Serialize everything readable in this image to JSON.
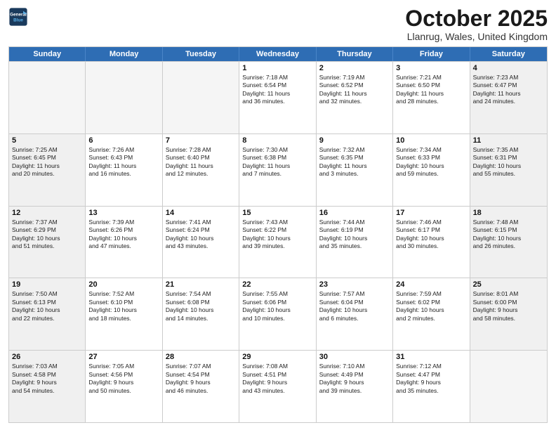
{
  "header": {
    "logo_line1": "General",
    "logo_line2": "Blue",
    "month": "October 2025",
    "location": "Llanrug, Wales, United Kingdom"
  },
  "days_of_week": [
    "Sunday",
    "Monday",
    "Tuesday",
    "Wednesday",
    "Thursday",
    "Friday",
    "Saturday"
  ],
  "weeks": [
    [
      {
        "day": "",
        "text": ""
      },
      {
        "day": "",
        "text": ""
      },
      {
        "day": "",
        "text": ""
      },
      {
        "day": "1",
        "text": "Sunrise: 7:18 AM\nSunset: 6:54 PM\nDaylight: 11 hours\nand 36 minutes."
      },
      {
        "day": "2",
        "text": "Sunrise: 7:19 AM\nSunset: 6:52 PM\nDaylight: 11 hours\nand 32 minutes."
      },
      {
        "day": "3",
        "text": "Sunrise: 7:21 AM\nSunset: 6:50 PM\nDaylight: 11 hours\nand 28 minutes."
      },
      {
        "day": "4",
        "text": "Sunrise: 7:23 AM\nSunset: 6:47 PM\nDaylight: 11 hours\nand 24 minutes."
      }
    ],
    [
      {
        "day": "5",
        "text": "Sunrise: 7:25 AM\nSunset: 6:45 PM\nDaylight: 11 hours\nand 20 minutes."
      },
      {
        "day": "6",
        "text": "Sunrise: 7:26 AM\nSunset: 6:43 PM\nDaylight: 11 hours\nand 16 minutes."
      },
      {
        "day": "7",
        "text": "Sunrise: 7:28 AM\nSunset: 6:40 PM\nDaylight: 11 hours\nand 12 minutes."
      },
      {
        "day": "8",
        "text": "Sunrise: 7:30 AM\nSunset: 6:38 PM\nDaylight: 11 hours\nand 7 minutes."
      },
      {
        "day": "9",
        "text": "Sunrise: 7:32 AM\nSunset: 6:35 PM\nDaylight: 11 hours\nand 3 minutes."
      },
      {
        "day": "10",
        "text": "Sunrise: 7:34 AM\nSunset: 6:33 PM\nDaylight: 10 hours\nand 59 minutes."
      },
      {
        "day": "11",
        "text": "Sunrise: 7:35 AM\nSunset: 6:31 PM\nDaylight: 10 hours\nand 55 minutes."
      }
    ],
    [
      {
        "day": "12",
        "text": "Sunrise: 7:37 AM\nSunset: 6:29 PM\nDaylight: 10 hours\nand 51 minutes."
      },
      {
        "day": "13",
        "text": "Sunrise: 7:39 AM\nSunset: 6:26 PM\nDaylight: 10 hours\nand 47 minutes."
      },
      {
        "day": "14",
        "text": "Sunrise: 7:41 AM\nSunset: 6:24 PM\nDaylight: 10 hours\nand 43 minutes."
      },
      {
        "day": "15",
        "text": "Sunrise: 7:43 AM\nSunset: 6:22 PM\nDaylight: 10 hours\nand 39 minutes."
      },
      {
        "day": "16",
        "text": "Sunrise: 7:44 AM\nSunset: 6:19 PM\nDaylight: 10 hours\nand 35 minutes."
      },
      {
        "day": "17",
        "text": "Sunrise: 7:46 AM\nSunset: 6:17 PM\nDaylight: 10 hours\nand 30 minutes."
      },
      {
        "day": "18",
        "text": "Sunrise: 7:48 AM\nSunset: 6:15 PM\nDaylight: 10 hours\nand 26 minutes."
      }
    ],
    [
      {
        "day": "19",
        "text": "Sunrise: 7:50 AM\nSunset: 6:13 PM\nDaylight: 10 hours\nand 22 minutes."
      },
      {
        "day": "20",
        "text": "Sunrise: 7:52 AM\nSunset: 6:10 PM\nDaylight: 10 hours\nand 18 minutes."
      },
      {
        "day": "21",
        "text": "Sunrise: 7:54 AM\nSunset: 6:08 PM\nDaylight: 10 hours\nand 14 minutes."
      },
      {
        "day": "22",
        "text": "Sunrise: 7:55 AM\nSunset: 6:06 PM\nDaylight: 10 hours\nand 10 minutes."
      },
      {
        "day": "23",
        "text": "Sunrise: 7:57 AM\nSunset: 6:04 PM\nDaylight: 10 hours\nand 6 minutes."
      },
      {
        "day": "24",
        "text": "Sunrise: 7:59 AM\nSunset: 6:02 PM\nDaylight: 10 hours\nand 2 minutes."
      },
      {
        "day": "25",
        "text": "Sunrise: 8:01 AM\nSunset: 6:00 PM\nDaylight: 9 hours\nand 58 minutes."
      }
    ],
    [
      {
        "day": "26",
        "text": "Sunrise: 7:03 AM\nSunset: 4:58 PM\nDaylight: 9 hours\nand 54 minutes."
      },
      {
        "day": "27",
        "text": "Sunrise: 7:05 AM\nSunset: 4:56 PM\nDaylight: 9 hours\nand 50 minutes."
      },
      {
        "day": "28",
        "text": "Sunrise: 7:07 AM\nSunset: 4:54 PM\nDaylight: 9 hours\nand 46 minutes."
      },
      {
        "day": "29",
        "text": "Sunrise: 7:08 AM\nSunset: 4:51 PM\nDaylight: 9 hours\nand 43 minutes."
      },
      {
        "day": "30",
        "text": "Sunrise: 7:10 AM\nSunset: 4:49 PM\nDaylight: 9 hours\nand 39 minutes."
      },
      {
        "day": "31",
        "text": "Sunrise: 7:12 AM\nSunset: 4:47 PM\nDaylight: 9 hours\nand 35 minutes."
      },
      {
        "day": "",
        "text": ""
      }
    ]
  ]
}
